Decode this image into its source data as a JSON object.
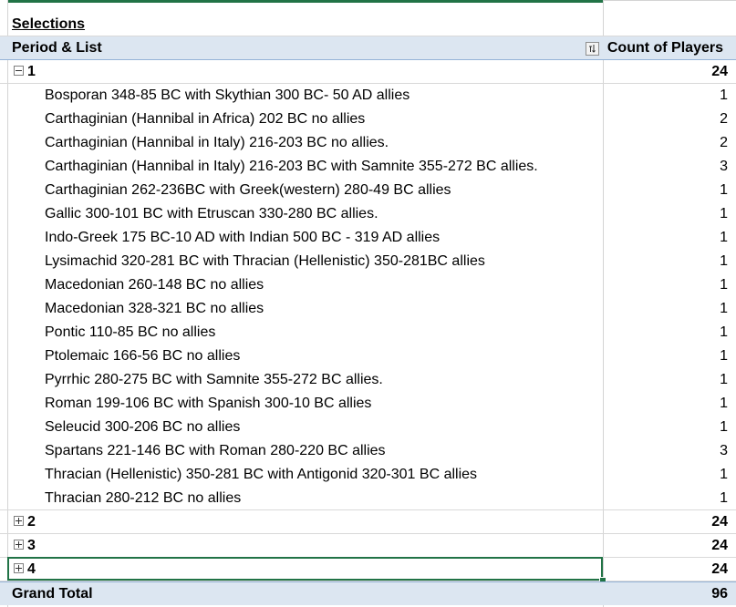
{
  "pivot": {
    "title": "Selections",
    "row_header": "Period & List",
    "value_header": "Count of Players",
    "groups": [
      {
        "label": "1",
        "total": "24",
        "expanded": true,
        "items": [
          {
            "name": "Bosporan 348-85 BC with Skythian 300 BC- 50 AD allies",
            "count": "1"
          },
          {
            "name": "Carthaginian (Hannibal in Africa) 202 BC no allies",
            "count": "2"
          },
          {
            "name": "Carthaginian (Hannibal in Italy) 216-203 BC no allies.",
            "count": "2"
          },
          {
            "name": "Carthaginian (Hannibal in Italy) 216-203 BC with Samnite 355-272 BC allies.",
            "count": "3"
          },
          {
            "name": "Carthaginian 262-236BC with Greek(western) 280-49 BC allies",
            "count": "1"
          },
          {
            "name": "Gallic 300-101 BC with Etruscan 330-280 BC allies.",
            "count": "1"
          },
          {
            "name": "Indo-Greek 175 BC-10 AD with Indian 500 BC - 319 AD allies",
            "count": "1"
          },
          {
            "name": "Lysimachid 320-281 BC with Thracian (Hellenistic) 350-281BC allies",
            "count": "1"
          },
          {
            "name": "Macedonian 260-148 BC no allies",
            "count": "1"
          },
          {
            "name": "Macedonian 328-321 BC no allies",
            "count": "1"
          },
          {
            "name": "Pontic 110-85 BC no allies",
            "count": "1"
          },
          {
            "name": "Ptolemaic 166-56 BC no allies",
            "count": "1"
          },
          {
            "name": "Pyrrhic 280-275 BC with Samnite 355-272 BC allies.",
            "count": "1"
          },
          {
            "name": "Roman 199-106 BC with Spanish 300-10 BC allies",
            "count": "1"
          },
          {
            "name": "Seleucid 300-206 BC no allies",
            "count": "1"
          },
          {
            "name": "Spartans 221-146 BC with Roman 280-220 BC allies",
            "count": "3"
          },
          {
            "name": "Thracian (Hellenistic) 350-281 BC with Antigonid 320-301 BC allies",
            "count": "1"
          },
          {
            "name": "Thracian 280-212 BC no allies",
            "count": "1"
          }
        ]
      },
      {
        "label": "2",
        "total": "24",
        "expanded": false,
        "items": []
      },
      {
        "label": "3",
        "total": "24",
        "expanded": false,
        "items": []
      },
      {
        "label": "4",
        "total": "24",
        "expanded": false,
        "items": []
      }
    ],
    "grand_total_label": "Grand Total",
    "grand_total_value": "96"
  },
  "colors": {
    "header_fill": "#dce6f1",
    "selection": "#217346",
    "gridline": "#d9d9d9"
  },
  "icons": {
    "collapse": "minus-box-icon",
    "expand": "plus-box-icon",
    "filter": "sort-filter-icon"
  }
}
